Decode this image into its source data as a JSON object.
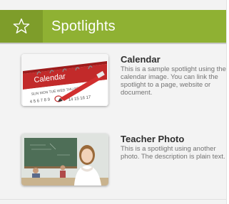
{
  "header": {
    "icon": "star-icon",
    "title": "Spotlights",
    "color": "#8fb133"
  },
  "spotlights": [
    {
      "title": "Calendar",
      "description": "This is a sample spotlight using the calendar image. You can link the spotlight to a page, website or document.",
      "image_icon": "calendar-image",
      "image_text": "Calendar"
    },
    {
      "title": "Teacher Photo",
      "description": "This is a spotlight using another photo. The description is plain text.",
      "image_icon": "teacher-photo-image"
    }
  ]
}
